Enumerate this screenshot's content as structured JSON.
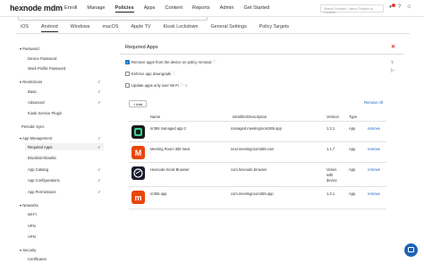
{
  "header": {
    "logo": "hexnode mdm",
    "nav": [
      "Enroll",
      "Manage",
      "Policies",
      "Apps",
      "Content",
      "Reports",
      "Admin",
      "Get Started"
    ],
    "active_nav": "Policies",
    "search_placeholder": "Search Devices, Users, Policies or Content"
  },
  "platform_tabs": [
    "iOS",
    "Android",
    "Windows",
    "macOS",
    "Apple TV",
    "Kiosk Lockdown",
    "General Settings",
    "Policy Targets"
  ],
  "active_tab": "Android",
  "sidebar": {
    "password": {
      "label": "Password",
      "items": [
        "Device Password",
        "Work Profile Password"
      ]
    },
    "restrictions": {
      "label": "Restrictions",
      "items": [
        "Basic",
        "Advanced",
        "Kiosk Service Plugin"
      ]
    },
    "periodic_sync": "Periodic Sync",
    "app_management": {
      "label": "App Management",
      "items": [
        "Required Apps",
        "Blocklist/Allowlist",
        "App Catalog",
        "App Configurations",
        "App Permissions"
      ]
    },
    "networks": {
      "label": "Networks",
      "items": [
        "Wi-Fi",
        "VPN",
        "APN"
      ]
    },
    "security": {
      "label": "Security",
      "items": [
        "Certificates"
      ]
    }
  },
  "panel": {
    "title": "Required Apps",
    "options": [
      {
        "label": "Remove apps from the device on policy removal",
        "checked": true
      },
      {
        "label": "Enforce app downgrade",
        "checked": false
      },
      {
        "label": "Update apps only over Wi-Fi",
        "checked": false
      }
    ],
    "add_label": "+ Add",
    "remove_all": "Remove All",
    "columns": [
      "Name",
      "Identifier/Description",
      "Version",
      "Type"
    ],
    "rows": [
      {
        "name": "nr365 managed app 2",
        "identifier": "managed.meetingroom365.app",
        "version": "1.3.1",
        "type": "App",
        "action": "remove",
        "icon_color": "#1b1b1b"
      },
      {
        "name": "Meeting Room 365 Next",
        "identifier": "next.meetingroom365.com",
        "version": "1.1.7",
        "type": "App",
        "action": "remove",
        "icon_color": "#e8450a"
      },
      {
        "name": "Hexnode Kiosk Browser",
        "identifier": "com.hexnode.browser",
        "version_lines": [
          "Varies",
          "with",
          "device"
        ],
        "type": "App",
        "action": "remove",
        "icon_color": "#1a1a2e"
      },
      {
        "name": "nr365 app",
        "identifier": "com.meetingroom365.app",
        "version": "1.3.1",
        "type": "App",
        "action": "remove",
        "icon_color": "#e8450a"
      }
    ]
  },
  "colors": {
    "accent": "#1976d2",
    "link": "#1565c0",
    "danger": "#d32f2f",
    "fab": "#1e63b5"
  }
}
